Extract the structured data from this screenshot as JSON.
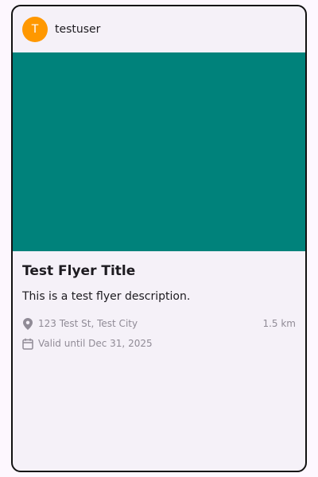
{
  "user": {
    "avatar_letter": "T",
    "username": "testuser"
  },
  "flyer": {
    "title": "Test Flyer Title",
    "description": "This is a test flyer description.",
    "address": "123 Test St, Test City",
    "distance": "1.5 km",
    "validity": "Valid until Dec 31, 2025",
    "image_color": "#00827b"
  },
  "colors": {
    "avatar": "#ff9800",
    "muted_text": "#908b96",
    "card_background": "#f5f1f8"
  },
  "icons": {
    "location": "location-pin-icon",
    "calendar": "calendar-icon"
  }
}
